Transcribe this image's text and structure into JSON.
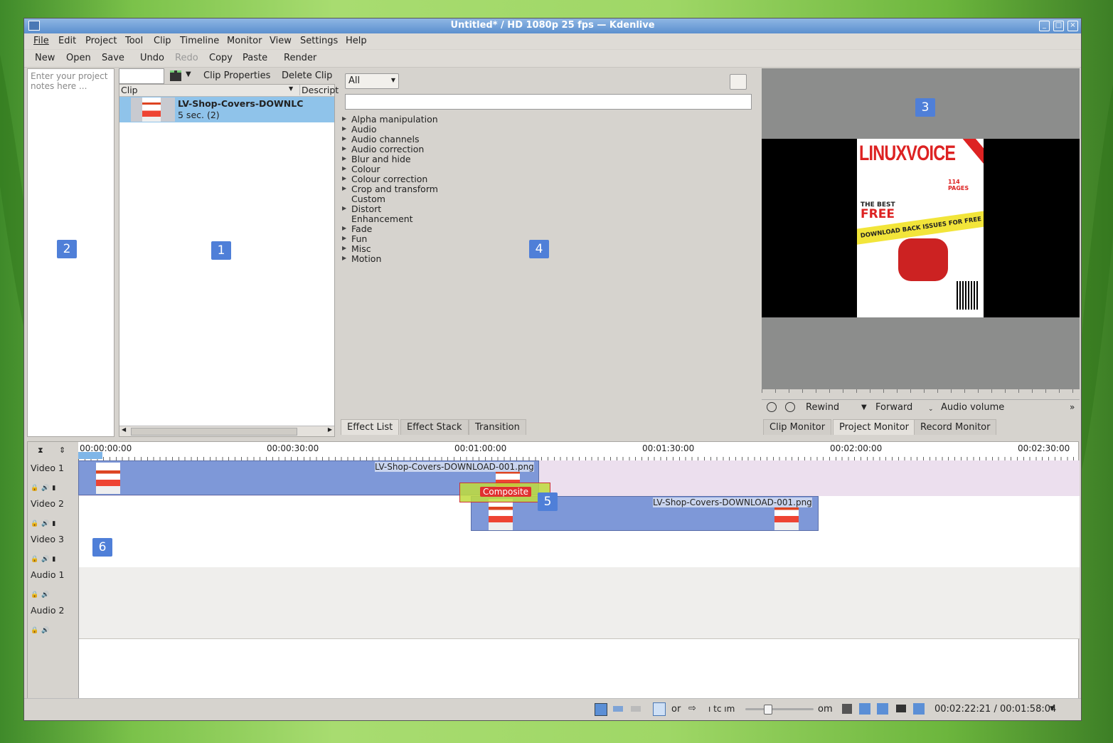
{
  "window": {
    "title": "Untitled* / HD 1080p 25 fps — Kdenlive"
  },
  "menu": [
    "File",
    "Edit",
    "Project",
    "Tool",
    "Clip",
    "Timeline",
    "Monitor",
    "View",
    "Settings",
    "Help"
  ],
  "toolbar": [
    "New",
    "Open",
    "Save",
    "Undo",
    "Redo",
    "Copy",
    "Paste",
    "Render"
  ],
  "notes": {
    "placeholder": "Enter your project notes here ..."
  },
  "project_bin": {
    "clip_properties": "Clip Properties",
    "delete_clip": "Delete Clip",
    "col_clip": "Clip",
    "col_desc": "Descript",
    "item_name": "LV-Shop-Covers-DOWNLC",
    "item_info": "5 sec. (2)"
  },
  "effects": {
    "filter": "All",
    "categories": [
      "Alpha manipulation",
      "Audio",
      "Audio channels",
      "Audio correction",
      "Blur and hide",
      "Colour",
      "Colour correction",
      "Crop and transform",
      "Custom",
      "Distort",
      "Enhancement",
      "Fade",
      "Fun",
      "Misc",
      "Motion"
    ],
    "tabs": [
      "Effect List",
      "Effect Stack",
      "Transition"
    ]
  },
  "monitor": {
    "cover": {
      "brand": "LINUXVOICE",
      "free": "FREE",
      "best": "THE BEST",
      "banner": "DOWNLOAD BACK ISSUES FOR FREE",
      "pages": "114 PAGES"
    },
    "controls": [
      "Rewind",
      "Forward",
      "Audio volume"
    ],
    "tabs": [
      "Clip Monitor",
      "Project Monitor",
      "Record Monitor"
    ]
  },
  "callouts": [
    "1",
    "2",
    "3",
    "4",
    "5",
    "6"
  ],
  "timeline": {
    "ruler": [
      "00:00:00:00",
      "00:00:30:00",
      "00:01:00:00",
      "00:01:30:00",
      "00:02:00:00",
      "00:02:30:00"
    ],
    "tracks": [
      "Video 1",
      "Video 2",
      "Video 3",
      "Audio 1",
      "Audio 2"
    ],
    "clip1": "LV-Shop-Covers-DOWNLOAD-001.png",
    "clip2": "LV-Shop-Covers-DOWNLOAD-001.png",
    "transition": "Composite"
  },
  "status": {
    "or": "or",
    "zoom_fragment": "ı tc ım",
    "zoom_om": "om",
    "timecode": "00:02:22:21 / 00:01:58:04",
    "zoom_level": 0.3
  }
}
